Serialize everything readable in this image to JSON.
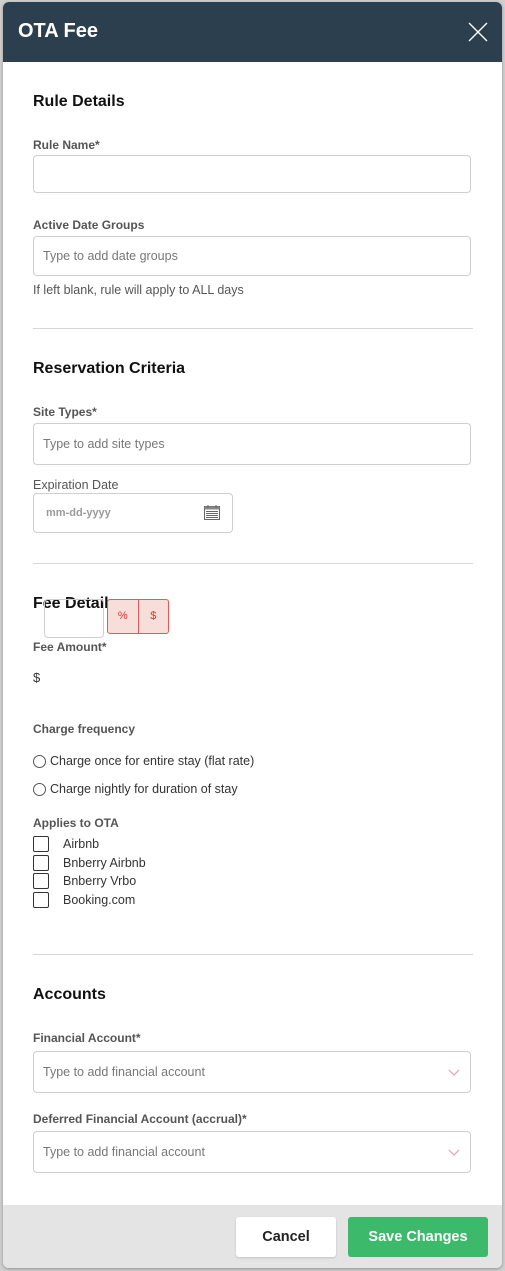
{
  "modal": {
    "title": "OTA Fee",
    "close_icon": "close-icon"
  },
  "rule_details": {
    "heading": "Rule Details",
    "rule_name_label": "Rule Name*",
    "rule_name_value": "",
    "date_groups_label": "Active Date Groups",
    "date_groups_placeholder": "Type to add date groups",
    "date_groups_hint": "If left blank, rule will apply to ALL days"
  },
  "reservation_criteria": {
    "heading": "Reservation Criteria",
    "site_types_label": "Site Types*",
    "site_types_placeholder": "Type to add site types",
    "expiration_label": "Expiration Date",
    "expiration_placeholder": "mm-dd-yyyy",
    "calendar_icon": "calendar-icon"
  },
  "fee_details": {
    "heading": "Fee Details",
    "fee_amount_label": "Fee Amount*",
    "currency_symbol": "$",
    "fee_amount_value": "",
    "toggle_options": [
      "%",
      "$"
    ],
    "charge_frequency_label": "Charge frequency",
    "charge_options": [
      {
        "label": "Charge once for entire stay (flat rate)",
        "selected": false
      },
      {
        "label": "Charge nightly for duration of stay",
        "selected": false
      }
    ],
    "applies_label": "Applies to OTA",
    "ota_options": [
      {
        "label": "Airbnb",
        "checked": false
      },
      {
        "label": "Bnberry Airbnb",
        "checked": false
      },
      {
        "label": "Bnberry Vrbo",
        "checked": false
      },
      {
        "label": "Booking.com",
        "checked": false
      }
    ]
  },
  "accounts": {
    "heading": "Accounts",
    "financial_label": "Financial Account*",
    "financial_placeholder": "Type to add financial account",
    "deferred_label": "Deferred Financial Account (accrual)*",
    "deferred_placeholder": "Type to add financial account"
  },
  "footer": {
    "cancel_label": "Cancel",
    "save_label": "Save Changes"
  },
  "colors": {
    "header_bg": "#2b3f4e",
    "save_green": "#3cb96a",
    "toggle_red": "#e05a5a"
  }
}
